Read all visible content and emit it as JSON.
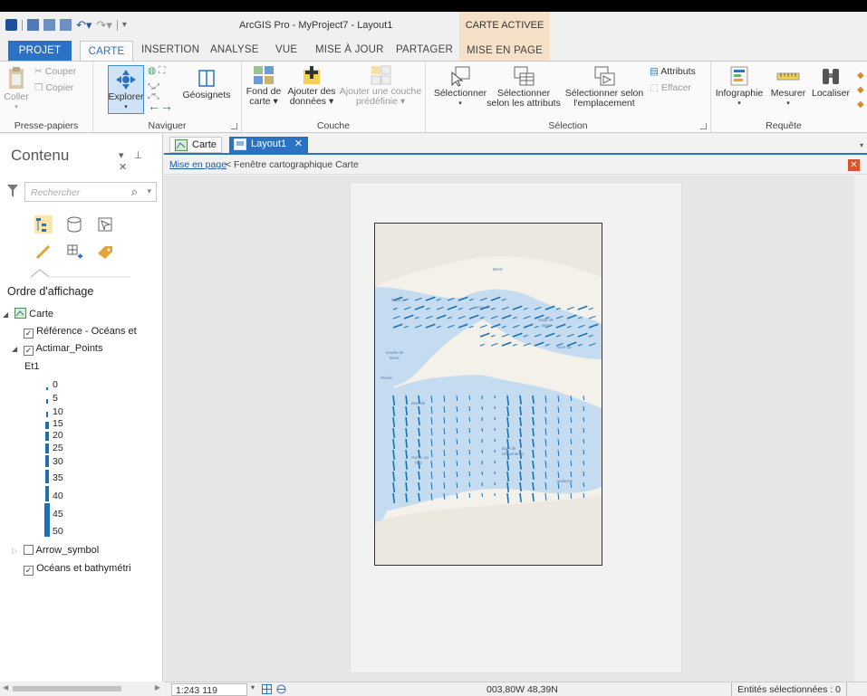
{
  "titlebar": {
    "title": "ArcGIS Pro - MyProject7 - Layout1",
    "context_banner": "CARTE ACTIVEE"
  },
  "tabs": {
    "projet": "PROJET",
    "carte": "CARTE",
    "insertion": "INSERTION",
    "analyse": "ANALYSE",
    "vue": "VUE",
    "mise_a_jour": "MISE À JOUR",
    "partager": "PARTAGER",
    "mise_en_page": "MISE EN PAGE"
  },
  "ribbon": {
    "presse_papiers": {
      "label": "Presse-papiers",
      "coller": "Coller",
      "couper": "Couper",
      "copier": "Copier"
    },
    "naviguer": {
      "label": "Naviguer",
      "explorer": "Explorer",
      "geosignets": "Géosignets"
    },
    "couche": {
      "label": "Couche",
      "fond_de_carte_1": "Fond de",
      "fond_de_carte_2": "carte ▾",
      "ajouter_donnees_1": "Ajouter des",
      "ajouter_donnees_2": "données ▾",
      "ajouter_couche_1": "Ajouter une couche",
      "ajouter_couche_2": "prédéfinie ▾"
    },
    "selection": {
      "label": "Sélection",
      "selectionner": "Sélectionner",
      "sel_attributs_1": "Sélectionner",
      "sel_attributs_2": "selon les attributs",
      "sel_emplacement_1": "Sélectionner selon",
      "sel_emplacement_2": "l'emplacement",
      "attributs": "Attributs",
      "effacer": "Effacer"
    },
    "requete": {
      "label": "Requête",
      "infographie": "Infographie",
      "mesurer": "Mesurer",
      "localiser": "Localiser"
    }
  },
  "contents": {
    "title": "Contenu",
    "pane_controls": "▾ ⊥ ✕",
    "search_placeholder": "Rechercher",
    "order_title": "Ordre d'affichage",
    "tree": {
      "map": "Carte",
      "layer_reference": "Référence - Océans et",
      "layer_actimar": "Actimar_Points",
      "field": "Et1",
      "legend_values": [
        "0",
        "5",
        "10",
        "15",
        "20",
        "25",
        "30",
        "35",
        "40",
        "45",
        "50"
      ],
      "layer_arrow": "Arrow_symbol",
      "layer_oceans": "Océans et bathymétri"
    }
  },
  "doctabs": {
    "carte": "Carte",
    "layout": "Layout1"
  },
  "breadcrumb": {
    "link": "Mise en page",
    "rest": "< Fenêtre cartographique Carte"
  },
  "map_labels": {
    "brest": "Brest",
    "lt1": "Pays de",
    "lt2": "Anse de",
    "lt3": "Anse de",
    "goulet": "Goulet de",
    "goulet2": "Brest",
    "rade": "Rade de",
    "rade2": "Brest",
    "l_ban": "Pointe",
    "l_iroise": "Baie de",
    "l_douarn": "Baie de",
    "l_douarn2": "Douarnenez",
    "l_pt": "Pointe du",
    "l_raz": "Raz",
    "l_gouet": "Audierne"
  },
  "status": {
    "scale": "1:243 119",
    "coords": "003,80W 48,39N",
    "selected": "Entités sélectionnées : 0"
  },
  "colors": {
    "accent": "#2b72c4",
    "context_tab": "#f6e0c8",
    "arrow": "#1b6fb3",
    "water": "#c5dcf0",
    "land": "#f4f1ea"
  }
}
